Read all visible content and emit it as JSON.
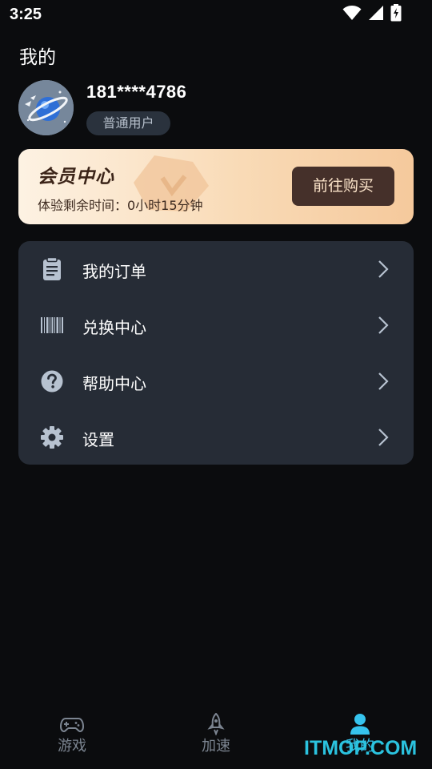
{
  "status_bar": {
    "time": "3:25",
    "icons": [
      "wifi-icon",
      "signal-icon",
      "battery-charging-icon"
    ]
  },
  "page": {
    "title": "我的"
  },
  "profile": {
    "phone": "181****4786",
    "badge": "普通用户",
    "avatar_icon": "planet-avatar-icon"
  },
  "vip": {
    "title": "会员中心",
    "subtitle": "体验剩余时间：0小时15分钟",
    "button": "前往购买",
    "colors": {
      "card_start": "#fdf2e3",
      "card_end": "#f5c99c",
      "button_bg": "#45302a",
      "button_text": "#fbe3c9"
    }
  },
  "menu": {
    "items": [
      {
        "label": "我的订单",
        "icon": "clipboard-icon"
      },
      {
        "label": "兑换中心",
        "icon": "barcode-icon"
      },
      {
        "label": "帮助中心",
        "icon": "help-circle-icon"
      },
      {
        "label": "设置",
        "icon": "gear-icon"
      }
    ]
  },
  "bottom_nav": {
    "items": [
      {
        "label": "游戏",
        "icon": "gamepad-icon",
        "active": false
      },
      {
        "label": "加速",
        "icon": "rocket-icon",
        "active": false
      },
      {
        "label": "我的",
        "icon": "user-icon",
        "active": true
      }
    ],
    "active_color": "#36c4ee",
    "inactive_color": "#7c8591"
  },
  "watermark": "ITMOP.COM"
}
